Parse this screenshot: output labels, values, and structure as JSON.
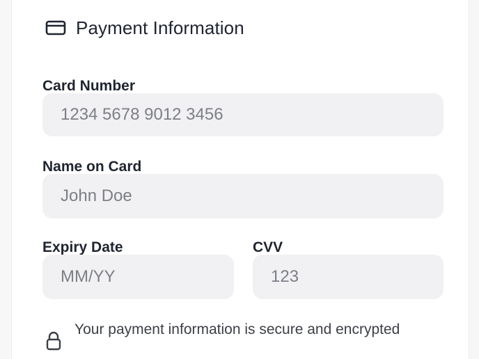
{
  "section": {
    "title": "Payment Information",
    "icon": "credit-card-icon"
  },
  "card_number": {
    "label": "Card Number",
    "placeholder": "1234 5678 9012 3456",
    "value": ""
  },
  "name_on_card": {
    "label": "Name on Card",
    "placeholder": "John Doe",
    "value": ""
  },
  "expiry_date": {
    "label": "Expiry Date",
    "placeholder": "MM/YY",
    "value": ""
  },
  "cvv": {
    "label": "CVV",
    "placeholder": "123",
    "value": ""
  },
  "security_note": {
    "icon": "lock-icon",
    "text": "Your payment information is secure and encrypted"
  },
  "colors": {
    "page_background": "#f7f7f8",
    "card_background": "#ffffff",
    "field_background": "#f1f1f3",
    "text_primary": "#1f2430",
    "placeholder": "#7d7f86"
  }
}
